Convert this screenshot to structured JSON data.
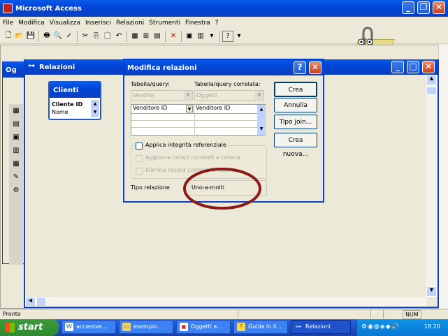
{
  "app": {
    "title": "Microsoft Access"
  },
  "menu": [
    "File",
    "Modifica",
    "Visualizza",
    "Inserisci",
    "Relazioni",
    "Strumenti",
    "Finestra",
    "?"
  ],
  "relwin": {
    "title": "Relazioni",
    "db_title_fragment": "Og"
  },
  "table": {
    "title": "Clienti",
    "fields": [
      "Cliente ID",
      "Nome"
    ]
  },
  "dialog": {
    "title": "Modifica relazioni",
    "table_label": "Tabella/query:",
    "related_label": "Tabella/query correlata:",
    "table_value": "Vendite",
    "related_value": "Oggetti",
    "grid_left": "Venditore ID",
    "grid_right": "Venditore ID",
    "integrity_label": "Applica integrità referenziale",
    "cascade_update_label": "Aggiorna campi correlati a catena",
    "cascade_delete_label": "Elimina record correlati a catena",
    "relation_type_label": "Tipo relazione",
    "relation_type_value": "Uno-a-molti",
    "buttons": {
      "create": "Crea",
      "cancel": "Annulla",
      "join": "Tipo join...",
      "new": "Crea nuova..."
    }
  },
  "status": {
    "text": "Pronto",
    "num": "NUM"
  },
  "taskbar": {
    "start": "start",
    "items": [
      "accessve...",
      "esempio ...",
      "Oggetti a...",
      "Guida in li...",
      "Relazioni"
    ],
    "clock": "18.20"
  },
  "colors": {
    "xp_blue": "#0046d8",
    "annotation": "#8b1a1a",
    "workspace": "#ece9d8"
  }
}
